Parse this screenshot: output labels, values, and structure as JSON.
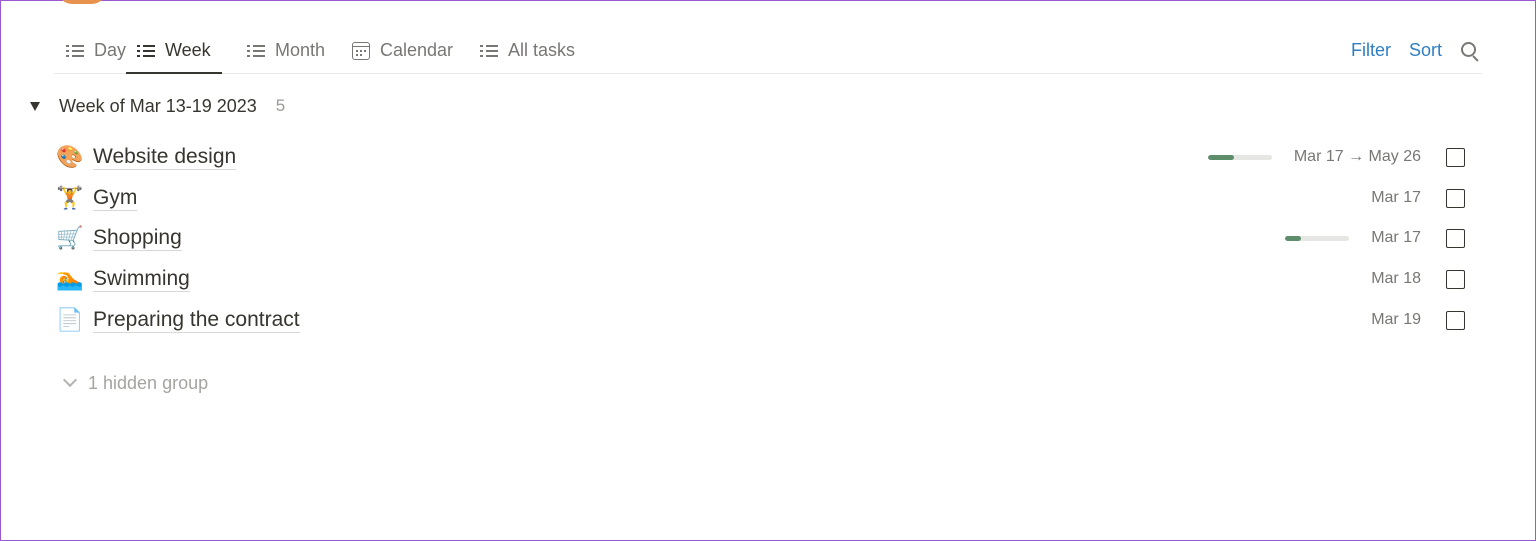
{
  "tabs": [
    {
      "label": "Day",
      "icon": "list-icon",
      "active": false
    },
    {
      "label": "Week",
      "icon": "list-icon",
      "active": true
    },
    {
      "label": "Month",
      "icon": "list-icon",
      "active": false
    },
    {
      "label": "Calendar",
      "icon": "calendar-icon",
      "active": false
    },
    {
      "label": "All tasks",
      "icon": "list-icon",
      "active": false
    }
  ],
  "actions": {
    "filter_label": "Filter",
    "sort_label": "Sort",
    "search_icon": "search-icon"
  },
  "accent_color": "#2f7fc1",
  "progress_color": "#5e8d6c",
  "group": {
    "title": "Week of Mar 13-19 2023",
    "count": "5"
  },
  "tasks": [
    {
      "icon": "🎨",
      "icon_name": "palette-icon",
      "title": "Website design",
      "date": "Mar 17 → May 26",
      "progress": 0.4,
      "checked": false
    },
    {
      "icon": "🏋️",
      "icon_name": "weightlifter-icon",
      "title": "Gym",
      "date": "Mar 17",
      "checked": false
    },
    {
      "icon": "🛒",
      "icon_name": "shopping-cart-icon",
      "title": "Shopping",
      "date": "Mar 17",
      "progress": 0.25,
      "checked": false
    },
    {
      "icon": "🏊",
      "icon_name": "swimmer-icon",
      "title": "Swimming",
      "date": "Mar 18",
      "checked": false
    },
    {
      "icon": "📄",
      "icon_name": "document-icon",
      "title": "Preparing the contract",
      "date": "Mar 19",
      "checked": false
    }
  ],
  "hidden_groups_label": "1 hidden group"
}
